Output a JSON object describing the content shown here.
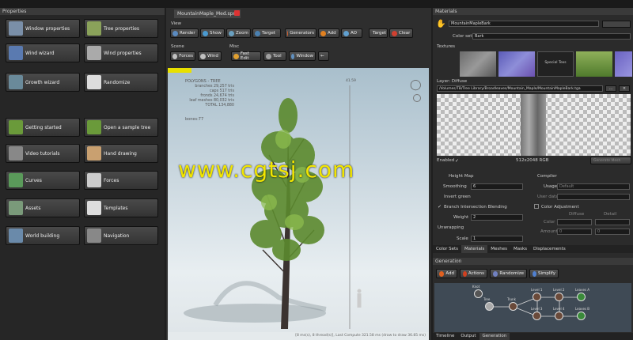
{
  "left_panel": {
    "title": "Properties",
    "buttons": [
      {
        "label": "Window properties",
        "icon": "window-icon"
      },
      {
        "label": "Tree properties",
        "icon": "tree-icon"
      },
      {
        "label": "Wind wizard",
        "icon": "wind-wizard-icon"
      },
      {
        "label": "Wind properties",
        "icon": "fan-icon"
      },
      {
        "label": "Growth wizard",
        "icon": "growth-icon"
      },
      {
        "label": "Randomize",
        "icon": "dice-icon"
      },
      {
        "label": "Getting started",
        "icon": "start-icon"
      },
      {
        "label": "Open a sample tree",
        "icon": "sample-tree-icon"
      },
      {
        "label": "Video tutorials",
        "icon": "play-icon"
      },
      {
        "label": "Hand drawing",
        "icon": "hand-icon"
      },
      {
        "label": "Curves",
        "icon": "curves-icon"
      },
      {
        "label": "Forces",
        "icon": "magnet-icon"
      },
      {
        "label": "Assets",
        "icon": "assets-icon"
      },
      {
        "label": "Templates",
        "icon": "templates-icon"
      },
      {
        "label": "World building",
        "icon": "world-icon"
      },
      {
        "label": "Navigation",
        "icon": "navigation-icon"
      }
    ]
  },
  "document_tab": "MountainMaple_Med.spm",
  "toolbar": {
    "view_label": "View",
    "view_buttons": [
      "Render",
      "Show",
      "Zoom",
      "Target"
    ],
    "edit_buttons": [
      "Generators",
      "Add",
      "AO",
      "Target",
      "Clear"
    ],
    "scene_label": "Scene",
    "scene_buttons": [
      "Forces",
      "Wind"
    ],
    "misc_label": "Misc",
    "misc_buttons": [
      "Fast Edit",
      "Tool",
      "Window"
    ]
  },
  "viewport": {
    "stats_heading": "POLYGONS - TREE",
    "stats": [
      "branches 29,257 tris",
      "caps 517 tris",
      "fronds 24,674 tris",
      "leaf meshes 80,032 tris",
      "TOTAL 134,880"
    ],
    "bones": "bones:77",
    "height_marker": "41.59",
    "status_bar": "[8 ms(s), 8 thread(s)], Last Compute 321.58 ms (draw to draw 36.85 ms)"
  },
  "materials": {
    "title": "Materials",
    "material_name": "MountainMapleBark",
    "color_set_label": "Color set",
    "color_set_value": "Bark",
    "textures_label": "Textures",
    "special_texture_label": "Special Texs",
    "layer_label": "Layer: Diffuse",
    "texture_path": "/Volumes/TB/Tree Library/Broadleaves/Mountain_Maple/MountainMapleBark.tga",
    "enabled_label": "Enabled",
    "texture_info": "512x2048 RGB",
    "generate_mesh": "Generate Mesh",
    "height_map_label": "Height Map",
    "smoothing_label": "Smoothing",
    "smoothing_value": "6",
    "invert_green_label": "Invert green",
    "compiler_label": "Compiler",
    "usage_label": "Usage",
    "usage_value": "Default",
    "user_data_label": "User data",
    "branch_blending_label": "Branch Intersection Blending",
    "weight_label": "Weight",
    "weight_value": "2",
    "color_adjustment_label": "Color Adjustment",
    "diffuse_label": "Diffuse",
    "detail_label": "Detail",
    "color_label": "Color",
    "amount_label": "Amount",
    "amount_value1": "0",
    "amount_value2": "0",
    "unwrapping_label": "Unwrapping",
    "scale_label": "Scale",
    "scale_value": "1",
    "tabs": [
      "Color Sets",
      "Materials",
      "Meshes",
      "Masks",
      "Displacements"
    ]
  },
  "generation": {
    "title": "Generation",
    "buttons": [
      "Add",
      "Actions",
      "Randomize",
      "Simplify"
    ],
    "nodes": [
      "Tree",
      "Trunk",
      "Level 1",
      "Level 2",
      "Level 3",
      "Level 4",
      "Leaves A",
      "Leaves B",
      "Knot"
    ],
    "bottom_tabs": [
      "Timeline",
      "Output",
      "Generation"
    ]
  },
  "watermark": "www.cgtsj.com"
}
